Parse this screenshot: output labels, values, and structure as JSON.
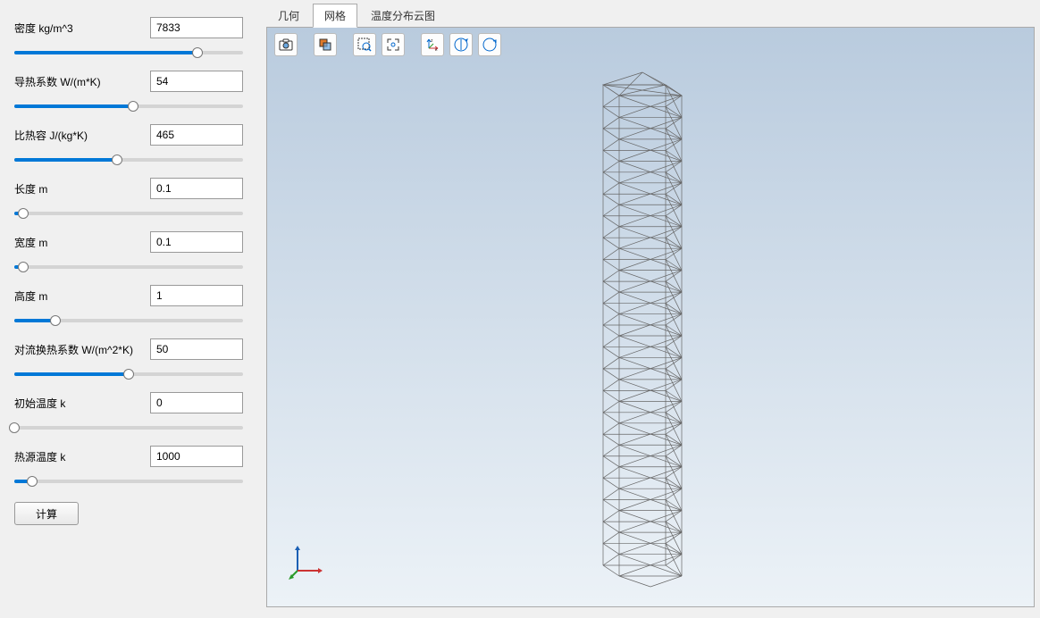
{
  "params": [
    {
      "label": "密度 kg/m^3",
      "value": "7833",
      "pos": 80
    },
    {
      "label": "导热系数 W/(m*K)",
      "value": "54",
      "pos": 52
    },
    {
      "label": "比热容 J/(kg*K)",
      "value": "465",
      "pos": 45
    },
    {
      "label": "长度 m",
      "value": "0.1",
      "pos": 4
    },
    {
      "label": "宽度 m",
      "value": "0.1",
      "pos": 4
    },
    {
      "label": "高度 m",
      "value": "1",
      "pos": 18
    },
    {
      "label": "对流换热系数 W/(m^2*K)",
      "value": "50",
      "pos": 50
    },
    {
      "label": "初始温度 k",
      "value": "0",
      "pos": 0
    },
    {
      "label": "热源温度 k",
      "value": "1000",
      "pos": 8
    }
  ],
  "compute_label": "计算",
  "tabs": [
    {
      "label": "几何",
      "active": false
    },
    {
      "label": "网格",
      "active": true
    },
    {
      "label": "温度分布云图",
      "active": false
    }
  ]
}
